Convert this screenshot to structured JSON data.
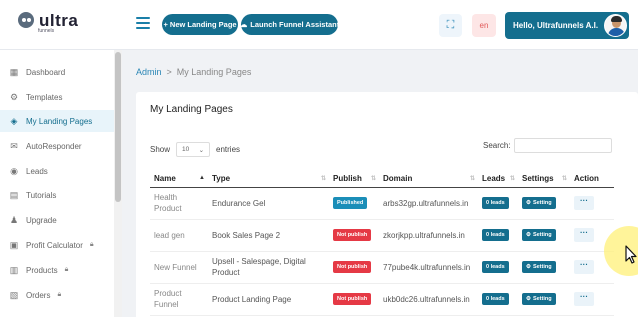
{
  "brand": {
    "logo_text": "ultra",
    "logo_sub": "funnels"
  },
  "header": {
    "new_landing_label": "+ New Landing Page",
    "assistant_label": "Launch Funnel Assistant",
    "lang_label": "en",
    "user_greeting": "Hello, Ultrafunnels A.I."
  },
  "sidebar": {
    "items": [
      {
        "label": "Dashboard",
        "icon": "dashboard-icon",
        "locked": false,
        "active": false
      },
      {
        "label": "Templates",
        "icon": "templates-icon",
        "locked": false,
        "active": false
      },
      {
        "label": "My Landing Pages",
        "icon": "layers-icon",
        "locked": false,
        "active": true
      },
      {
        "label": "AutoResponder",
        "icon": "mail-icon",
        "locked": false,
        "active": false
      },
      {
        "label": "Leads",
        "icon": "leads-icon",
        "locked": false,
        "active": false
      },
      {
        "label": "Tutorials",
        "icon": "tutorials-icon",
        "locked": false,
        "active": false
      },
      {
        "label": "Upgrade",
        "icon": "users-icon",
        "locked": false,
        "active": false
      },
      {
        "label": "Profit Calculator",
        "icon": "calculator-icon",
        "locked": true,
        "active": false
      },
      {
        "label": "Products",
        "icon": "products-icon",
        "locked": true,
        "active": false
      },
      {
        "label": "Orders",
        "icon": "orders-icon",
        "locked": true,
        "active": false
      }
    ]
  },
  "breadcrumb": {
    "home": "Admin",
    "separator": ">",
    "current": "My Landing Pages"
  },
  "card": {
    "title": "My Landing Pages"
  },
  "table_controls": {
    "show_label": "Show",
    "show_value": "10",
    "entries_label": "entries",
    "search_label": "Search:"
  },
  "table": {
    "headers": [
      "Name",
      "Type",
      "Publish",
      "Domain",
      "Leads",
      "Settings",
      "Action"
    ],
    "rows": [
      {
        "name": "Health Product",
        "type": "Endurance Gel",
        "publish": "Published",
        "published": true,
        "domain": "arbs32gp.ultrafunnels.in",
        "leads": "0 leads",
        "setting": "Setting",
        "action": "···"
      },
      {
        "name": "lead gen",
        "type": "Book Sales Page 2",
        "publish": "Not publish",
        "published": false,
        "domain": "zkorjkpp.ultrafunnels.in",
        "leads": "0 leads",
        "setting": "Setting",
        "action": "···"
      },
      {
        "name": "New Funnel",
        "type": "Upsell - Salespage, Digital Product",
        "publish": "Not publish",
        "published": false,
        "domain": "77pube4k.ultrafunnels.in",
        "leads": "0 leads",
        "setting": "Setting",
        "action": "···"
      },
      {
        "name": "Product Funnel",
        "type": "Product Landing Page",
        "publish": "Not publish",
        "published": false,
        "domain": "ukb0dc26.ultrafunnels.in",
        "leads": "0 leads",
        "setting": "Setting",
        "action": "···"
      }
    ]
  },
  "colors": {
    "primary": "#146e8e",
    "published": "#1b8eb8",
    "not_published": "#e53945",
    "lang_bg": "#fde6e6"
  }
}
